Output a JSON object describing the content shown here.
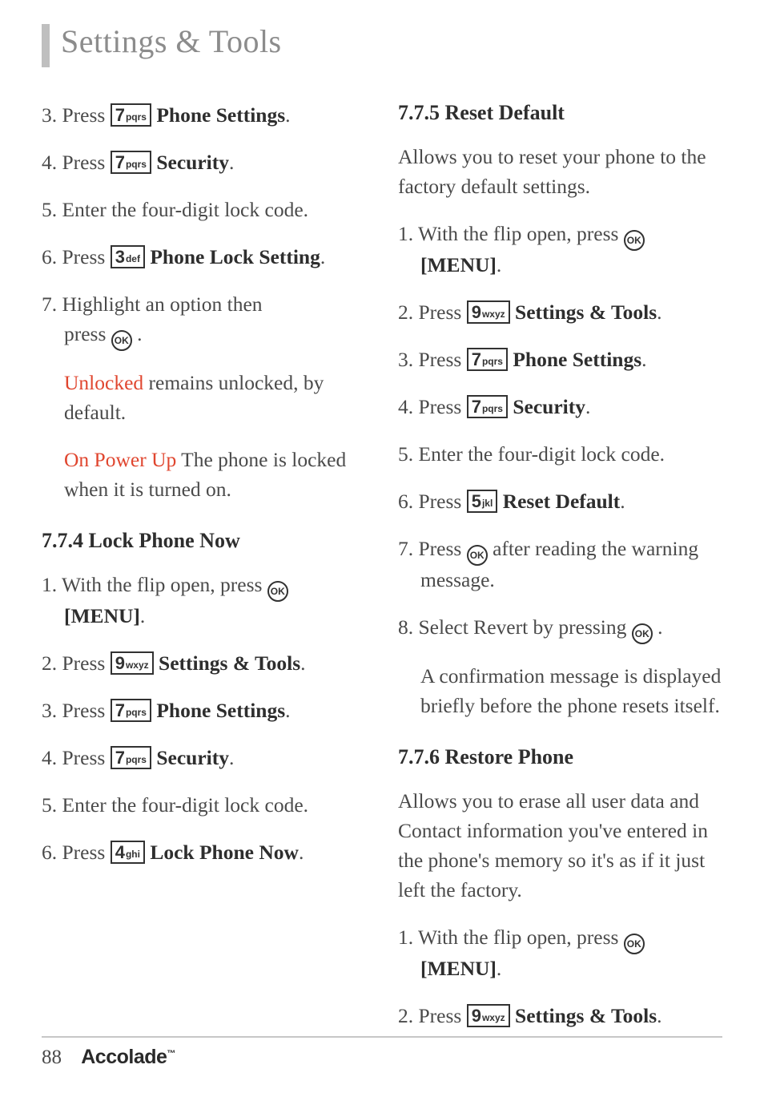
{
  "title": "Settings & Tools",
  "footer": {
    "page": "88",
    "brand": "Accolade"
  },
  "keys": {
    "k3": {
      "digit": "3",
      "sub": "def"
    },
    "k4": {
      "digit": "4",
      "sub": "ghi"
    },
    "k5": {
      "digit": "5",
      "sub": "jkl"
    },
    "k7": {
      "digit": "7",
      "sub": "pqrs"
    },
    "k9": {
      "digit": "9",
      "sub": "wxyz"
    }
  },
  "ok_label": "OK",
  "col1": {
    "s3": {
      "pre": "3. Press ",
      "bold": " Phone Settings",
      "post": "."
    },
    "s4": {
      "pre": "4. Press ",
      "bold": " Security",
      "post": "."
    },
    "s5": "5. Enter the four-digit lock code.",
    "s6": {
      "pre": "6. Press ",
      "bold": " Phone Lock Setting",
      "post": "."
    },
    "s7a": "7. Highlight an option then",
    "s7b": "press ",
    "s7c": " .",
    "opt1_hl": "Unlocked",
    "opt1_rest": "  remains unlocked, by default.",
    "opt2_hl": "On Power Up",
    "opt2_rest": "  The phone is locked when it is turned on.",
    "h774": "7.7.4 Lock Phone Now",
    "lpn1a": "1. With the flip open, press  ",
    "lpn1b_bold": "[MENU]",
    "lpn1c": ".",
    "lpn2": {
      "pre": "2. Press ",
      "bold": " Settings & Tools",
      "post": "."
    },
    "lpn3": {
      "pre": "3. Press ",
      "bold": " Phone Settings",
      "post": "."
    },
    "lpn4": {
      "pre": "4. Press ",
      "bold": " Security",
      "post": "."
    },
    "lpn5": "5. Enter the four-digit lock code.",
    "lpn6": {
      "pre": "6. Press ",
      "bold": " Lock Phone Now",
      "post": "."
    }
  },
  "col2": {
    "h775": "7.7.5 Reset Default",
    "p775": "Allows you to reset your phone to the factory default settings.",
    "rd1a": "1. With the flip open, press ",
    "rd1b_bold": "[MENU]",
    "rd1c": ".",
    "rd2": {
      "pre": "2. Press ",
      "bold": " Settings & Tools",
      "post": "."
    },
    "rd3": {
      "pre": "3. Press ",
      "bold": " Phone Settings",
      "post": "."
    },
    "rd4": {
      "pre": "4. Press ",
      "bold": " Security",
      "post": "."
    },
    "rd5": "5. Enter the four-digit lock code.",
    "rd6": {
      "pre": "6. Press ",
      "bold": " Reset Default",
      "post": "."
    },
    "rd7a": "7. Press  ",
    "rd7b": " after reading the warning message.",
    "rd8a": "8. Select Revert by pressing  ",
    "rd8b": " .",
    "rd_note": "A confirmation message is displayed briefly before the phone resets itself.",
    "h776": "7.7.6 Restore Phone",
    "p776": "Allows you to erase all user data and Contact information you've entered in the phone's memory so it's as if it just left the factory.",
    "rp1a": "1. With the flip open, press  ",
    "rp1b_bold": "[MENU]",
    "rp1c": ".",
    "rp2": {
      "pre": "2. Press ",
      "bold": " Settings & Tools",
      "post": "."
    }
  }
}
